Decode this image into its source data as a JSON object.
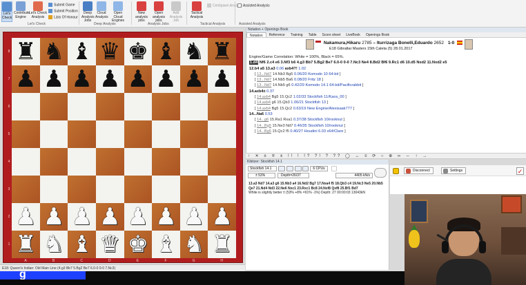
{
  "ribbon": {
    "lets_check": "Let's Check",
    "contribute_engine": "Contribute Engine",
    "lets_check_analysis": "Let's Check Analysis",
    "submit_game": "Submit Game",
    "submit_position": "Submit Position",
    "lists_of_honour": "Lists Of Honour",
    "group_lets_check": "Let's Check",
    "deep_analysis_jobs": "Deep Analysis Jobs",
    "cloud_analysis": "Cloud Analysis",
    "open_cloud_engines": "Open Cloud Engines",
    "group_deep_analysis": "Deep Analysis",
    "new_analysis_jobs": "New analysis jobs",
    "open_analysis_jobs": "Open analysis jobs",
    "add_analysis_job": "Add Analysis Job",
    "group_analysis_jobs": "Analysis Jobs",
    "tactical_analysis": "Tactical Analysis",
    "group_tactical_analysis": "Tactical Analysis",
    "centipawn_analysis": "Centipawn Analysis",
    "assisted_analysis_check": "Assisted Analysis",
    "group_assisted_analysis": "Assisted Analysis"
  },
  "board": {
    "ranks": [
      "8",
      "7",
      "6",
      "5",
      "4",
      "3",
      "2",
      "1"
    ],
    "files": [
      "A",
      "B",
      "C",
      "D",
      "E",
      "F",
      "G",
      "H"
    ],
    "pieces": [
      [
        "b:♜",
        "b:♞",
        "b:♝",
        "b:♛",
        "b:♚",
        "b:♝",
        "b:♞",
        "b:♜"
      ],
      [
        "b:♟",
        "b:♟",
        "b:♟",
        "b:♟",
        "b:♟",
        "b:♟",
        "b:♟",
        "b:♟"
      ],
      [
        "",
        "",
        "",
        "",
        "",
        "",
        "",
        ""
      ],
      [
        "",
        "",
        "",
        "",
        "",
        "",
        "",
        ""
      ],
      [
        "",
        "",
        "",
        "",
        "",
        "",
        "",
        ""
      ],
      [
        "",
        "",
        "",
        "",
        "",
        "",
        "",
        ""
      ],
      [
        "w:♟",
        "w:♟",
        "w:♟",
        "w:♟",
        "w:♟",
        "w:♟",
        "w:♟",
        "w:♟"
      ],
      [
        "w:♜",
        "w:♞",
        "w:♝",
        "w:♛",
        "w:♚",
        "w:♝",
        "w:♞",
        "w:♜"
      ]
    ]
  },
  "status_bar": "E18: Queen's Indian: Old Main Line (4.g3 Bb7 5.Bg2 Be7 6.0-0 0-0 7.Nc3)",
  "notation": {
    "panel_title": "Notation + Openings Book",
    "tabs": [
      "Notation",
      "Reference",
      "Training",
      "Table",
      "Score sheet",
      "LiveBook",
      "Openings Book"
    ],
    "white_player": "Nakamura,Hikaru",
    "white_elo": "2785",
    "black_player": "Iturrizaga Bonelli,Eduardo",
    "black_elo": "2652",
    "result": "1-0",
    "event_line": "E18 Gibraltar Masters 15th Caleta (5) 28.01.2017",
    "correlation": "Engine/Game Correlation: White = 100%, Black = 65%.",
    "main_line_current": "1.d4",
    "main_line_rest": "Nf6 2.c4 e6 3.Nf3 b6 4.g3 Bb7 5.Bg2 Be7 6.0-0 0-0 7.Nc3 Ne4 8.Bd2 Bf6 9.Rc1 d6 10.d5 Nxd2 11.Nxd2 e5",
    "main_line_2a": "12.b4 a5 13.a3",
    "main_line_2b": "0.06",
    "main_line_2c": "axb4?!",
    "main_line_2d": "1.02",
    "variations": [
      {
        "bracket_open": "[",
        "move": "13...Nd7",
        "text": "14.Nb3 Bg5",
        "eval": "0.06/20",
        "engine": "Komodo 10 64-bit",
        "bracket_close": "]"
      },
      {
        "bracket_open": "[",
        "move": "13...Nd7",
        "text": "14.Nb5 Ba6",
        "eval": "0.08/20",
        "engine": "Fritz 18",
        "bracket_close": "]"
      },
      {
        "bracket_open": "[",
        "move": "13...Nd7",
        "text": "14.Nb5 g6",
        "eval": "0.42/29",
        "engine": "Komodo 14.1 64-bit/Pacificrabbit",
        "bracket_close": "]"
      }
    ],
    "line_14": "14.axb4±",
    "line_14_eval": "0.37",
    "variations2": [
      {
        "bracket_open": "[",
        "move": "14.axb4",
        "text": "Bg5 15.Qc2",
        "eval": "1.02/33",
        "engine": "Stockfish 11/Kaos_00",
        "bracket_close": "]"
      },
      {
        "bracket_open": "[",
        "move": "14.axb4",
        "text": "g6 15.Qb3",
        "eval": "1.06/21",
        "engine": "Stockfish 13",
        "bracket_close": "]"
      },
      {
        "bracket_open": "[",
        "move": "14.axb4",
        "text": "Bg5 15.Qc2",
        "eval": "0.63/19",
        "engine": "New Engine/Alexisaak777",
        "bracket_close": "]"
      }
    ],
    "line_14b": "14...Na6",
    "line_14b_eval": "0.53",
    "variations3": [
      {
        "bracket_open": "[",
        "move": "14...g6",
        "text": "15.Ra1 Rxa1",
        "eval": "0.37/38",
        "engine": "Stockfish 10/rooknut",
        "bracket_close": "]"
      },
      {
        "bracket_open": "[",
        "move": "14...Bg5",
        "text": "15.Ne3 Nd7",
        "eval": "0.46/35",
        "engine": "Stockfish 10/rooknut",
        "bracket_close": "]"
      },
      {
        "bracket_open": "[",
        "move": "14...Bg5",
        "text": "15.Qc2 f5",
        "eval": "0.40/27",
        "engine": "Houdini 6.03 x64/Clare",
        "bracket_close": "]"
      }
    ],
    "toolbar_glyphs": "↑ ✕ ± ∓ ± !! ! !? ?! ? ?? ◯ ↔ ≡ ⟳ ○ ⊕ ∞ ⇔ ↑ →"
  },
  "engine": {
    "panel_title": "Kibitzer: Stockfish 14.1",
    "name": "Stockfish 14.1",
    "cpus": "6 CPUs",
    "eval": "± 53%",
    "depth": "Depth=26/37",
    "nps": "4405 kN/s",
    "line1": "13.a3 Nd7 14.a3 g6 15.Nb3 a4 16.Nd2 Bg7 17.Nxa4 f5 18.Qb3 c4 19.Nc3 Ne5 20.Nb5 Qe7 21.Nd4 Nd3 22.Ne6 Nxc1 23.Rxc1 Bc8 24.Nxf8 Qxf8 25.Bf1 Bd7",
    "line2": "White is slightly better ± (53% +8% =91% -1%)  Depth: 27   00:00:03  13043kN"
  },
  "right_panel": {
    "disconnect": "Disconnect",
    "settings": "Settings",
    "check_glyph": "✓"
  },
  "colors": {
    "board_frame": "#b11d1f",
    "dark_square": "#b8632c",
    "light_square": "#f3f3ef",
    "variation_eval": "#1a3fb0"
  }
}
